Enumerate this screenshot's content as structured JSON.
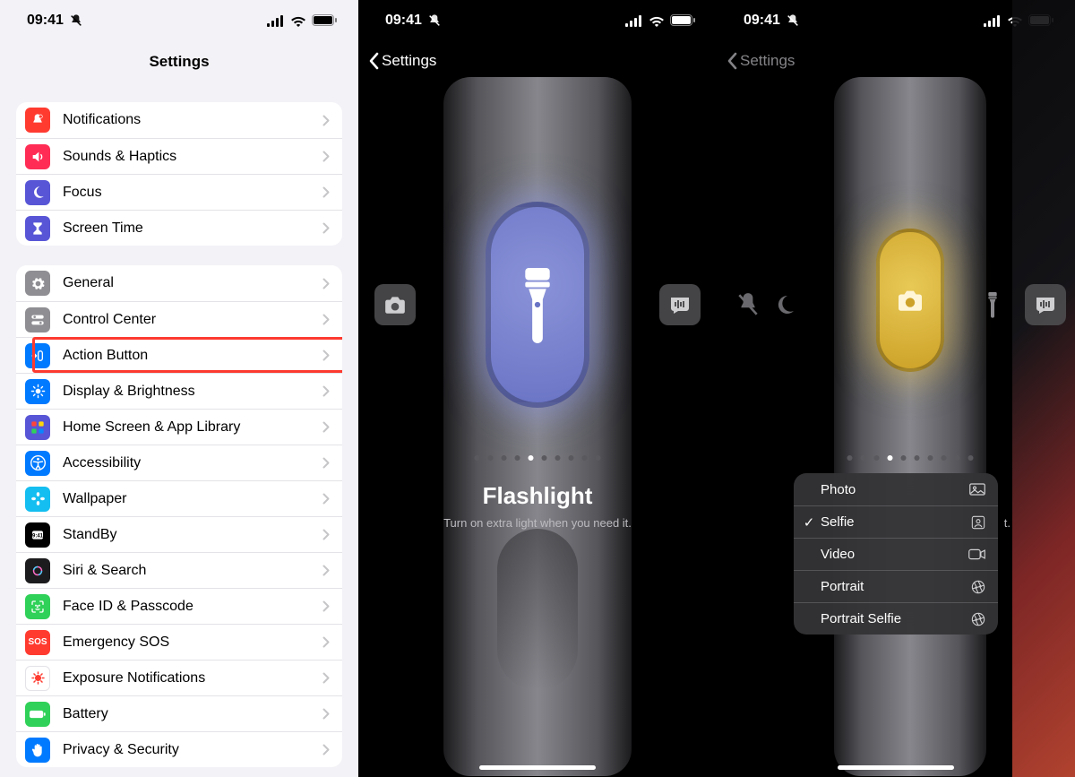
{
  "status": {
    "time": "09:41"
  },
  "screen1": {
    "title": "Settings",
    "group1": [
      {
        "icon": "bell-badge-icon",
        "color": "#ff3b30",
        "label": "Notifications"
      },
      {
        "icon": "speaker-icon",
        "color": "#ff2d55",
        "label": "Sounds & Haptics"
      },
      {
        "icon": "moon-icon",
        "color": "#5856d6",
        "label": "Focus"
      },
      {
        "icon": "hourglass-icon",
        "color": "#5856d6",
        "label": "Screen Time"
      }
    ],
    "group2": [
      {
        "icon": "gear-icon",
        "color": "#8e8e93",
        "label": "General"
      },
      {
        "icon": "switches-icon",
        "color": "#8e8e93",
        "label": "Control Center"
      },
      {
        "icon": "action-icon",
        "color": "#007aff",
        "label": "Action Button",
        "highlight": true
      },
      {
        "icon": "sun-icon",
        "color": "#007aff",
        "label": "Display & Brightness"
      },
      {
        "icon": "apps-grid-icon",
        "color": "#5856d6",
        "label": "Home Screen & App Library"
      },
      {
        "icon": "accessibility-icon",
        "color": "#007aff",
        "label": "Accessibility"
      },
      {
        "icon": "flower-icon",
        "color": "#14bef0",
        "label": "Wallpaper"
      },
      {
        "icon": "clock-icon",
        "color": "#000000",
        "label": "StandBy"
      },
      {
        "icon": "siri-icon",
        "color": "#1c1c1e",
        "label": "Siri & Search"
      },
      {
        "icon": "faceid-icon",
        "color": "#30d158",
        "label": "Face ID & Passcode"
      },
      {
        "icon": "sos-icon",
        "color": "#ff3b30",
        "label": "Emergency SOS",
        "iconText": "SOS"
      },
      {
        "icon": "virus-icon",
        "color": "#ffffff",
        "label": "Exposure Notifications",
        "iconFg": "#ff3b30"
      },
      {
        "icon": "battery-icon",
        "color": "#30d158",
        "label": "Battery"
      },
      {
        "icon": "hand-icon",
        "color": "#007aff",
        "label": "Privacy & Security"
      }
    ]
  },
  "screen2": {
    "back": "Settings",
    "pagerCount": 10,
    "pagerActive": 4,
    "title": "Flashlight",
    "subtitle": "Turn on extra light when you need it."
  },
  "screen3": {
    "back": "Settings",
    "pagerCount": 10,
    "pagerActive": 3,
    "menu": [
      {
        "label": "Photo",
        "icon": "photo-landscape-icon",
        "checked": false
      },
      {
        "label": "Selfie",
        "icon": "person-square-icon",
        "checked": true
      },
      {
        "label": "Video",
        "icon": "video-icon",
        "checked": false
      },
      {
        "label": "Portrait",
        "icon": "aperture-icon",
        "checked": false
      },
      {
        "label": "Portrait Selfie",
        "icon": "aperture-icon",
        "checked": false
      }
    ],
    "hiddenSubtitle": "t."
  }
}
